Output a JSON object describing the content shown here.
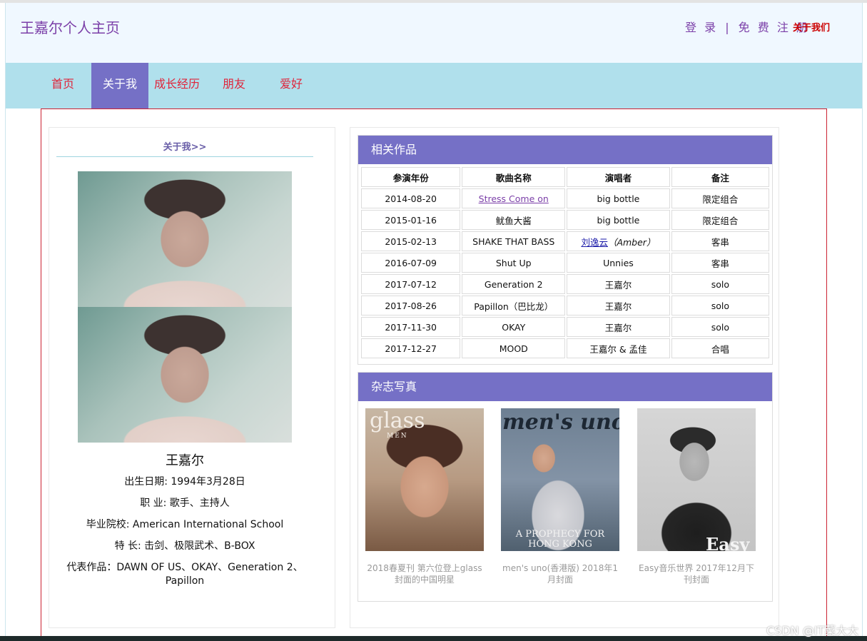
{
  "header": {
    "site_title": "王嘉尔个人主页",
    "login": "登 录",
    "separator": "|",
    "register": "免 费 注 册",
    "about_us": "关于我们"
  },
  "nav": {
    "items": [
      {
        "label": "首页"
      },
      {
        "label": "关于我",
        "active": true
      },
      {
        "label": "成长经历"
      },
      {
        "label": "朋友"
      },
      {
        "label": "爱好"
      }
    ],
    "active_color": "#7570c6",
    "bar_color": "#b0e0ec"
  },
  "profile": {
    "heading": "关于我>>",
    "name": "王嘉尔",
    "birth": "出生日期: 1994年3月28日",
    "job": "职 业: 歌手、主持人",
    "school": "毕业院校: American International School",
    "skills": "特 长: 击剑、极限武术、B-BOX",
    "works_line1": "代表作品：DAWN OF US、OKAY、Generation 2、",
    "works_line2": "Papillon"
  },
  "works": {
    "title": "相关作品",
    "headers": [
      "参演年份",
      "歌曲名称",
      "演唱者",
      "备注"
    ],
    "rows": [
      {
        "date": "2014-08-20",
        "song": "Stress Come on",
        "singer": "big bottle",
        "note": "限定组合"
      },
      {
        "date": "2015-01-16",
        "song": "鱿鱼大酱",
        "singer": "big bottle",
        "note": "限定组合"
      },
      {
        "date": "2015-02-13",
        "song": "SHAKE THAT BASS",
        "singer_link": "刘逸云",
        "singer_extra": "（Amber）",
        "note": "客串"
      },
      {
        "date": "2016-07-09",
        "song": "Shut Up",
        "singer": "Unnies",
        "note": "客串"
      },
      {
        "date": "2017-07-12",
        "song": "Generation 2",
        "singer": "王嘉尔",
        "note": "solo"
      },
      {
        "date": "2017-08-26",
        "song": "Papillon（巴比龙）",
        "singer": "王嘉尔",
        "note": "solo"
      },
      {
        "date": "2017-11-30",
        "song": "OKAY",
        "singer": "王嘉尔",
        "note": "solo"
      },
      {
        "date": "2017-12-27",
        "song": "MOOD",
        "singer": "王嘉尔 & 孟佳",
        "note": "合唱"
      }
    ]
  },
  "magazines": {
    "title": "杂志写真",
    "items": [
      {
        "caption": "2018春夏刊 第六位登上glass封面的中国明星",
        "cover_word": "glass",
        "cover_sub": "MEN"
      },
      {
        "caption": "men's uno(香港版) 2018年1月封面",
        "cover_word": "men's uno",
        "cover_sub": "A PROPHECY FOR HONG KONG"
      },
      {
        "caption": "Easy音乐世界 2017年12月下刊封面",
        "cover_word": "Easy"
      }
    ]
  },
  "watermark": "CSDN @IT菜大大"
}
